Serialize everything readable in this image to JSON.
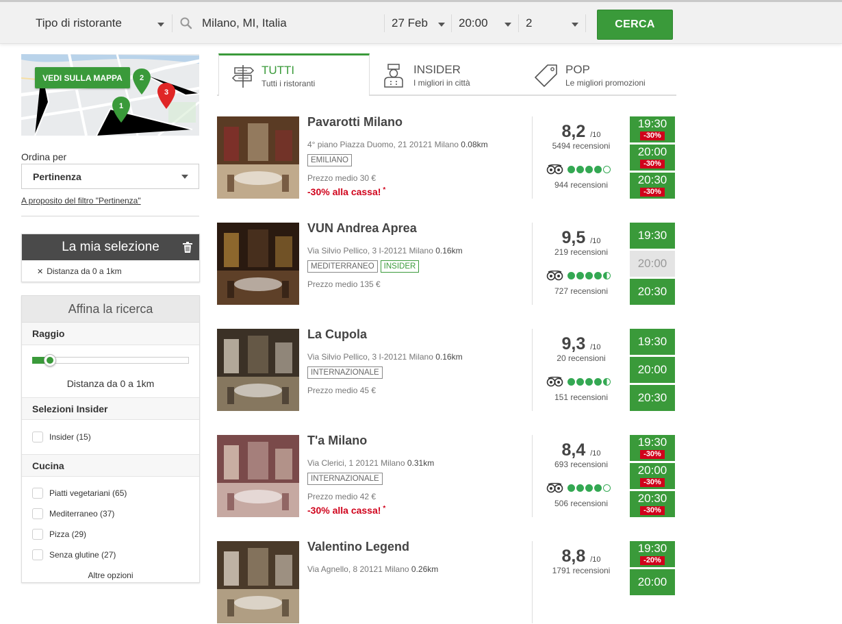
{
  "search": {
    "type_label": "Tipo di ristorante",
    "location": "Milano, MI, Italia",
    "date": "27 Feb",
    "time": "20:00",
    "people": "2",
    "button": "CERCA"
  },
  "sidebar": {
    "map_button": "VEDI SULLA MAPPA",
    "map_pins": [
      "1",
      "2",
      "3"
    ],
    "sort_label": "Ordina per",
    "sort_value": "Pertinenza",
    "sort_link": "A proposito del filtro \"Pertinenza\"",
    "selection": {
      "title": "La mia selezione",
      "item": "Distanza da 0 a 1km"
    },
    "refine": {
      "title": "Affina la ricerca",
      "radius_title": "Raggio",
      "radius_text": "Distanza da 0 a 1km",
      "radius_fraction": 0.06,
      "insider_title": "Selezioni Insider",
      "insider_options": [
        "Insider (15)"
      ],
      "cuisine_title": "Cucina",
      "cuisine_options": [
        "Piatti vegetariani (65)",
        "Mediterraneo (37)",
        "Pizza (29)",
        "Senza glutine (27)"
      ],
      "more": "Altre opzioni"
    }
  },
  "tabs": [
    {
      "title": "TUTTI",
      "subtitle": "Tutti i ristoranti"
    },
    {
      "title": "INSIDER",
      "subtitle": "I migliori in città"
    },
    {
      "title": "POP",
      "subtitle": "Le migliori promozioni"
    }
  ],
  "restaurants": [
    {
      "name": "Pavarotti Milano",
      "address": "4° piano Piazza Duomo, 21 20121 Milano",
      "distance": "0.08km",
      "tags": [
        "EMILIANO"
      ],
      "price": "Prezzo medio 30 €",
      "promo": "-30% alla cassa!",
      "score": "8,2",
      "score_max": "/10",
      "reviews": "5494 recensioni",
      "ta_rating": 4,
      "ta_reviews": "944 recensioni",
      "slots": [
        {
          "time": "19:30",
          "discount": "-30%"
        },
        {
          "time": "20:00",
          "discount": "-30%"
        },
        {
          "time": "20:30",
          "discount": "-30%"
        }
      ]
    },
    {
      "name": "VUN Andrea Aprea",
      "address": "Via Silvio Pellico, 3 I-20121 Milano",
      "distance": "0.16km",
      "tags": [
        "MEDITERRANEO",
        "INSIDER"
      ],
      "price": "Prezzo medio 135 €",
      "promo": "",
      "score": "9,5",
      "score_max": "/10",
      "reviews": "219 recensioni",
      "ta_rating": 4.5,
      "ta_reviews": "727 recensioni",
      "slots": [
        {
          "time": "19:30",
          "discount": ""
        },
        {
          "time": "20:00",
          "discount": "",
          "disabled": true
        },
        {
          "time": "20:30",
          "discount": ""
        }
      ]
    },
    {
      "name": "La Cupola",
      "address": "Via Silvio Pellico, 3 I-20121 Milano",
      "distance": "0.16km",
      "tags": [
        "INTERNAZIONALE"
      ],
      "price": "Prezzo medio 45 €",
      "promo": "",
      "score": "9,3",
      "score_max": "/10",
      "reviews": "20 recensioni",
      "ta_rating": 4.5,
      "ta_reviews": "151 recensioni",
      "slots": [
        {
          "time": "19:30",
          "discount": ""
        },
        {
          "time": "20:00",
          "discount": ""
        },
        {
          "time": "20:30",
          "discount": ""
        }
      ]
    },
    {
      "name": "T'a Milano",
      "address": "Via Clerici, 1 20121 Milano",
      "distance": "0.31km",
      "tags": [
        "INTERNAZIONALE"
      ],
      "price": "Prezzo medio 42 €",
      "promo": "-30% alla cassa!",
      "score": "8,4",
      "score_max": "/10",
      "reviews": "693 recensioni",
      "ta_rating": 4,
      "ta_reviews": "506 recensioni",
      "slots": [
        {
          "time": "19:30",
          "discount": "-30%"
        },
        {
          "time": "20:00",
          "discount": "-30%"
        },
        {
          "time": "20:30",
          "discount": "-30%"
        }
      ]
    },
    {
      "name": "Valentino Legend",
      "address": "Via Agnello, 8 20121 Milano",
      "distance": "0.26km",
      "tags": [],
      "price": "",
      "promo": "",
      "score": "8,8",
      "score_max": "/10",
      "reviews": "1791 recensioni",
      "ta_rating": 0,
      "ta_reviews": "",
      "slots": [
        {
          "time": "19:30",
          "discount": "-20%"
        },
        {
          "time": "20:00",
          "discount": ""
        }
      ]
    }
  ],
  "colors": {
    "accent": "#3a9a3a",
    "promo": "#d0021b",
    "tripadvisor": "#34a853"
  }
}
